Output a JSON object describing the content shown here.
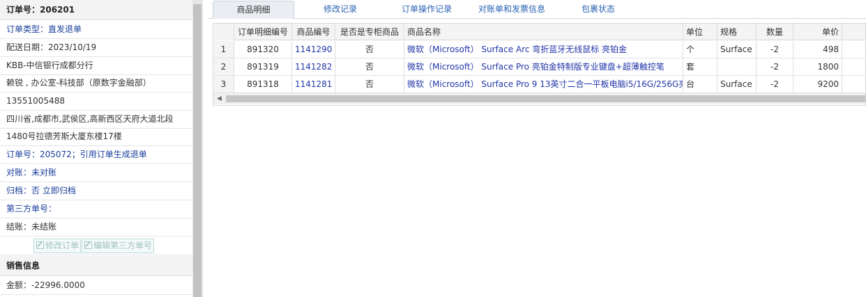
{
  "order": {
    "order_no": "订单号：206201",
    "type": "订单类型：直发退单",
    "delivery_date": "配送日期：2023/10/19",
    "branch": "KBB-中信银行成都分行",
    "contact": "赖锐 , 办公室-科技部（原数字金融部）",
    "phone": "13551005488",
    "address_line1": "四川省,成都市,武侯区,高新西区天府大道北段",
    "address_line2": "1480号拉德芳斯大厦东楼17楼",
    "ref_order": "订单号：205072；引用订单生成退单",
    "reconcile": "对账：未对账",
    "archive_label": "归档：",
    "archive_value": "否 立即归档",
    "third_party": "第三方单号：",
    "settlement": "结账：未结账"
  },
  "buttons": {
    "edit_order": "修改订单",
    "edit_third_party": "编辑第三方单号"
  },
  "sales": {
    "title": "销售信息",
    "amount": "金额：-22996.0000"
  },
  "tabs": [
    "商品明细",
    "修改记录",
    "订单操作记录",
    "对账单和发票信息",
    "包裹状态"
  ],
  "grid": {
    "columns": [
      "订单明细编号",
      "商品编号",
      "是否是专柜商品",
      "商品名称",
      "单位",
      "规格",
      "数量",
      "单价"
    ],
    "rows": [
      {
        "idx": "1",
        "detail_id": "891320",
        "product_id": "1141290",
        "counter": "否",
        "name": "微软（Microsoft） Surface Arc 弯折蓝牙无线鼠标 亮铂金",
        "unit": "个",
        "spec": "Surface",
        "qty": "-2",
        "price": "498"
      },
      {
        "idx": "2",
        "detail_id": "891319",
        "product_id": "1141282",
        "counter": "否",
        "name": "微软（Microsoft） Surface Pro 亮铂金特制版专业键盘+超薄触控笔",
        "unit": "套",
        "spec": "",
        "qty": "-2",
        "price": "1800"
      },
      {
        "idx": "3",
        "detail_id": "891318",
        "product_id": "1141281",
        "counter": "否",
        "name": "微软（Microsoft） Surface Pro 9 13英寸二合一平板电脑i5/16G/256G亮铂金",
        "unit": "台",
        "spec": "Surface",
        "qty": "-2",
        "price": "9200"
      }
    ]
  },
  "icons": {
    "edit": "edit-icon",
    "scroll_left": "arrow-left-icon"
  }
}
